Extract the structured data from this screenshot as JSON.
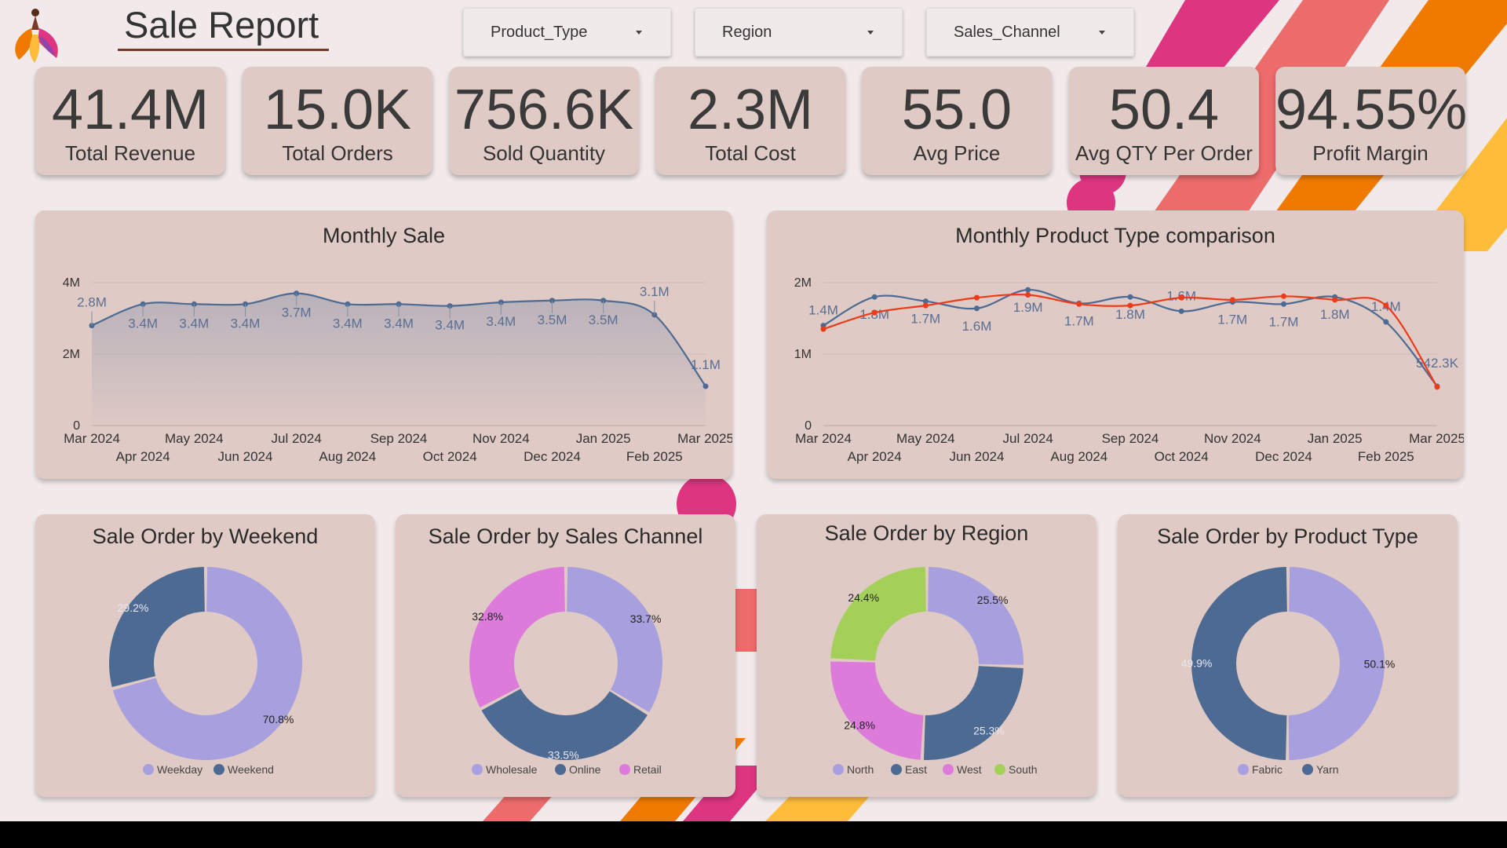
{
  "header": {
    "title": "Sale Report"
  },
  "filters": [
    {
      "label": "Product_Type"
    },
    {
      "label": "Region"
    },
    {
      "label": "Sales_Channel"
    }
  ],
  "kpis": [
    {
      "value": "41.4M",
      "label": "Total Revenue"
    },
    {
      "value": "15.0K",
      "label": "Total Orders"
    },
    {
      "value": "756.6K",
      "label": "Sold Quantity"
    },
    {
      "value": "2.3M",
      "label": "Total Cost"
    },
    {
      "value": "55.0",
      "label": "Avg Price"
    },
    {
      "value": "50.4",
      "label": "Avg QTY Per Order"
    },
    {
      "value": "94.55%",
      "label": "Profit Margin"
    }
  ],
  "colors": {
    "background": "#f2eaea",
    "card": "#dfcac5",
    "series_blue": "#4c6a92",
    "series_red": "#ee3a18",
    "lavender": "#a79fde",
    "orchid": "#dd7bdb",
    "lime": "#a4d05a"
  },
  "chart_data": [
    {
      "type": "area",
      "title": "Monthly Sale",
      "x": [
        "Mar 2024",
        "Apr 2024",
        "May 2024",
        "Jun 2024",
        "Jul 2024",
        "Aug 2024",
        "Sep 2024",
        "Oct 2024",
        "Nov 2024",
        "Dec 2024",
        "Jan 2025",
        "Feb 2025",
        "Mar 2025"
      ],
      "series": [
        {
          "values": [
            2800000,
            3400000,
            3400000,
            3400000,
            3700000,
            3400000,
            3400000,
            3350000,
            3450000,
            3500000,
            3500000,
            3100000,
            1100000
          ],
          "labels": [
            "2.8M",
            "3.4M",
            "3.4M",
            "3.4M",
            "3.7M",
            "3.4M",
            "3.4M",
            "3.4M",
            "3.4M",
            "3.5M",
            "3.5M",
            "3.1M",
            "1.1M"
          ]
        }
      ],
      "yticks": [
        {
          "v": 0,
          "label": "0"
        },
        {
          "v": 2000000,
          "label": "2M"
        },
        {
          "v": 4000000,
          "label": "4M"
        }
      ],
      "ylim": [
        0,
        4000000
      ],
      "grid": true
    },
    {
      "type": "line",
      "title": "Monthly Product Type comparison",
      "x": [
        "Mar 2024",
        "Apr 2024",
        "May 2024",
        "Jun 2024",
        "Jul 2024",
        "Aug 2024",
        "Sep 2024",
        "Oct 2024",
        "Nov 2024",
        "Dec 2024",
        "Jan 2025",
        "Feb 2025",
        "Mar 2025"
      ],
      "series": [
        {
          "values": [
            1400000,
            1800000,
            1740000,
            1640000,
            1900000,
            1710000,
            1800000,
            1600000,
            1730000,
            1700000,
            1800000,
            1450000,
            550000
          ],
          "labels": [
            "1.4M",
            "1.8M",
            "1.7M",
            "1.6M",
            "1.9M",
            "1.7M",
            "1.8M",
            "1.6M",
            "1.7M",
            "1.7M",
            "1.8M",
            "1.4M",
            "542.3K"
          ]
        },
        {
          "values": [
            1350000,
            1580000,
            1680000,
            1790000,
            1830000,
            1700000,
            1680000,
            1790000,
            1760000,
            1810000,
            1760000,
            1680000,
            540000
          ],
          "labels": []
        }
      ],
      "yticks": [
        {
          "v": 0,
          "label": "0"
        },
        {
          "v": 1000000,
          "label": "1M"
        },
        {
          "v": 2000000,
          "label": "2M"
        }
      ],
      "ylim": [
        0,
        2000000
      ],
      "grid": true
    },
    {
      "type": "pie",
      "title": "Sale Order by Weekend",
      "slices": [
        {
          "name": "Weekday",
          "value": 70.8,
          "label": "70.8%",
          "color": "#a79fde",
          "labelColor": "#222"
        },
        {
          "name": "Weekend",
          "value": 29.2,
          "label": "29.2%",
          "color": "#4c6a92",
          "labelColor": "#e8e8f0"
        }
      ]
    },
    {
      "type": "pie",
      "title": "Sale Order by Sales Channel",
      "slices": [
        {
          "name": "Wholesale",
          "value": 33.7,
          "label": "33.7%",
          "color": "#a79fde",
          "labelColor": "#222"
        },
        {
          "name": "Online",
          "value": 33.5,
          "label": "33.5%",
          "color": "#4c6a92",
          "labelColor": "#e8e8f0"
        },
        {
          "name": "Retail",
          "value": 32.8,
          "label": "32.8%",
          "color": "#dd7bdb",
          "labelColor": "#222"
        }
      ]
    },
    {
      "type": "pie",
      "title": "Sale Order by Region",
      "slices": [
        {
          "name": "North",
          "value": 25.5,
          "label": "25.5%",
          "color": "#a79fde",
          "labelColor": "#222"
        },
        {
          "name": "East",
          "value": 25.3,
          "label": "25.3%",
          "color": "#4c6a92",
          "labelColor": "#e8e8f0"
        },
        {
          "name": "West",
          "value": 24.8,
          "label": "24.8%",
          "color": "#dd7bdb",
          "labelColor": "#222"
        },
        {
          "name": "South",
          "value": 24.4,
          "label": "24.4%",
          "color": "#a4d05a",
          "labelColor": "#222"
        }
      ]
    },
    {
      "type": "pie",
      "title": "Sale Order by Product Type",
      "slices": [
        {
          "name": "Fabric",
          "value": 50.1,
          "label": "50.1%",
          "color": "#a79fde",
          "labelColor": "#222"
        },
        {
          "name": "Yarn",
          "value": 49.9,
          "label": "49.9%",
          "color": "#4c6a92",
          "labelColor": "#e8e8f0"
        }
      ]
    }
  ]
}
